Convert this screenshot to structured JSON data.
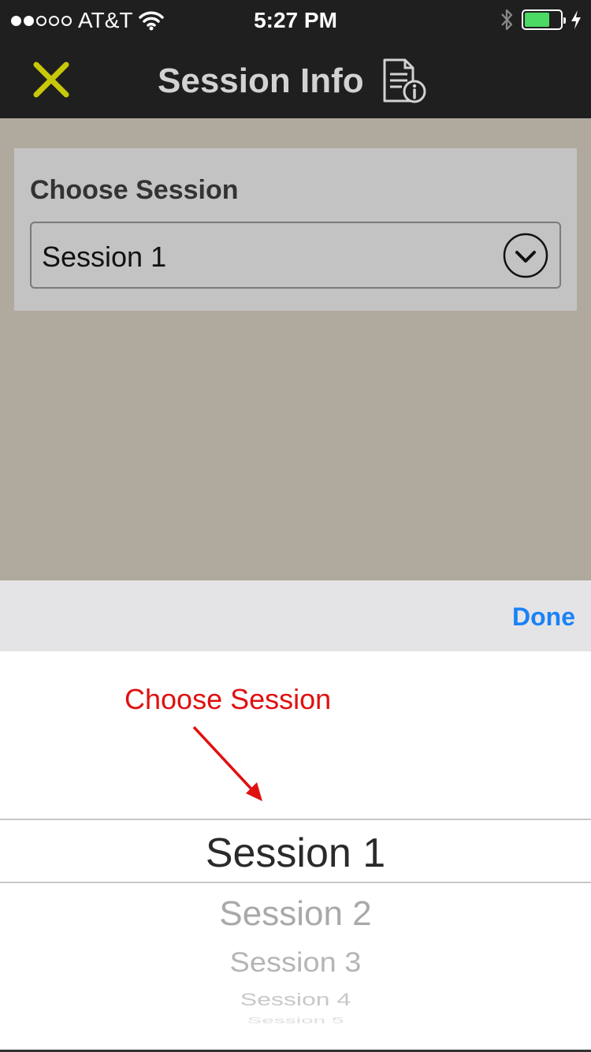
{
  "status_bar": {
    "carrier": "AT&T",
    "time": "5:27 PM",
    "signal_strength": 2,
    "signal_max": 5,
    "battery_level": 0.7,
    "icons": [
      "signal-dots-icon",
      "wifi-icon",
      "bluetooth-icon",
      "battery-icon",
      "charging-bolt-icon"
    ]
  },
  "nav": {
    "title": "Session Info",
    "close_icon": "close-icon",
    "title_icon": "document-info-icon",
    "accent_color": "#c8c80a"
  },
  "session_form": {
    "label": "Choose Session",
    "selected_value": "Session 1",
    "dropdown_icon": "chevron-down-circle-icon"
  },
  "toolbar": {
    "done_label": "Done",
    "done_color": "#1a82f7"
  },
  "picker": {
    "annotation_text": "Choose Session",
    "annotation_color": "#e01010",
    "options": [
      "Session 1",
      "Session 2",
      "Session 3",
      "Session 4",
      "Session 5"
    ],
    "selected_index": 0
  }
}
